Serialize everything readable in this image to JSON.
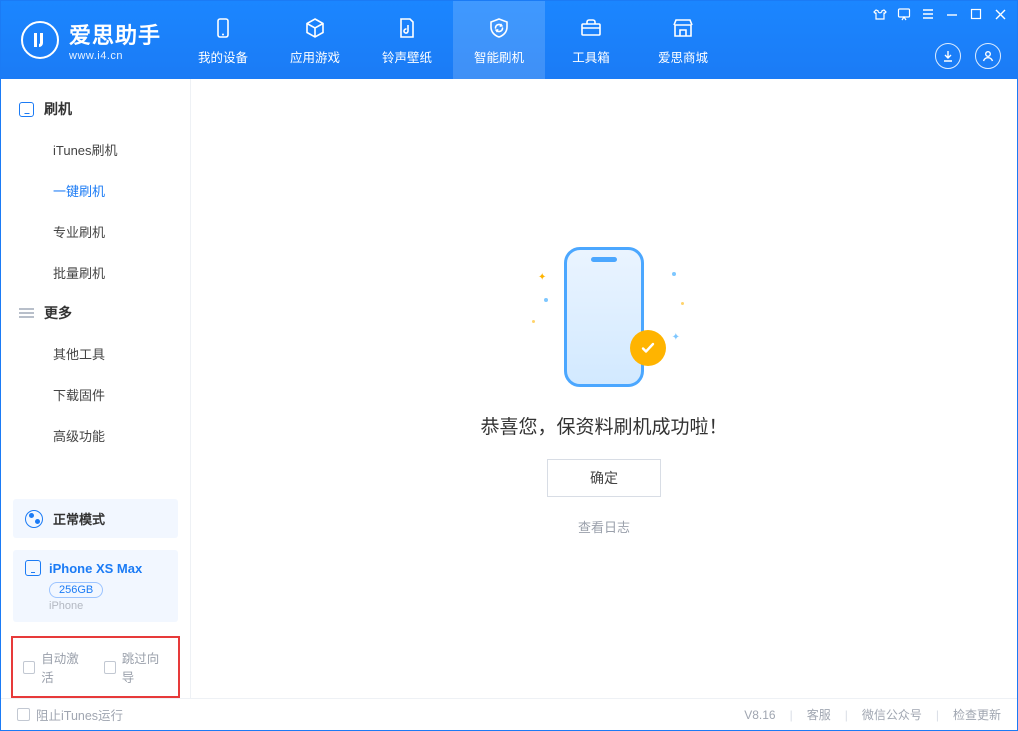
{
  "app": {
    "name": "爱思助手",
    "url": "www.i4.cn"
  },
  "tabs": [
    {
      "label": "我的设备",
      "icon": "device-icon"
    },
    {
      "label": "应用游戏",
      "icon": "cube-icon"
    },
    {
      "label": "铃声壁纸",
      "icon": "music-file-icon"
    },
    {
      "label": "智能刷机",
      "icon": "refresh-shield-icon",
      "active": true
    },
    {
      "label": "工具箱",
      "icon": "toolbox-icon"
    },
    {
      "label": "爱思商城",
      "icon": "store-icon"
    }
  ],
  "sidebar": {
    "sections": [
      {
        "title": "刷机",
        "icon": "phone-icon",
        "items": [
          "iTunes刷机",
          "一键刷机",
          "专业刷机",
          "批量刷机"
        ],
        "activeIndex": 1
      },
      {
        "title": "更多",
        "icon": "menu-icon",
        "items": [
          "其他工具",
          "下载固件",
          "高级功能"
        ]
      }
    ],
    "mode": {
      "label": "正常模式"
    },
    "device": {
      "name": "iPhone XS Max",
      "storage": "256GB",
      "type": "iPhone"
    },
    "options": {
      "auto_activate": "自动激活",
      "skip_guide": "跳过向导"
    }
  },
  "main": {
    "success_text": "恭喜您，保资料刷机成功啦！",
    "ok_button": "确定",
    "view_log": "查看日志"
  },
  "footer": {
    "block_itunes": "阻止iTunes运行",
    "version": "V8.16",
    "links": [
      "客服",
      "微信公众号",
      "检查更新"
    ]
  }
}
